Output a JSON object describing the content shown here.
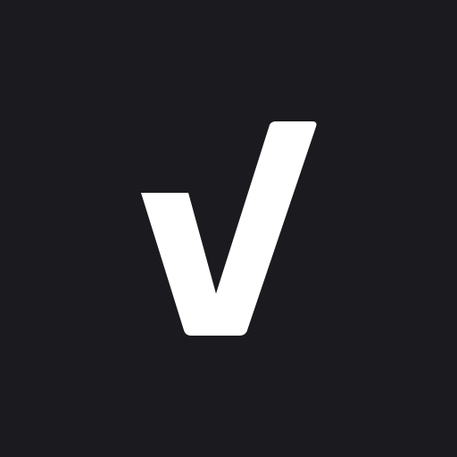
{
  "app_icon": {
    "background_color": "#1b1b1f",
    "mark_color": "#ffffff",
    "icon": "checkmark-logo-icon"
  }
}
